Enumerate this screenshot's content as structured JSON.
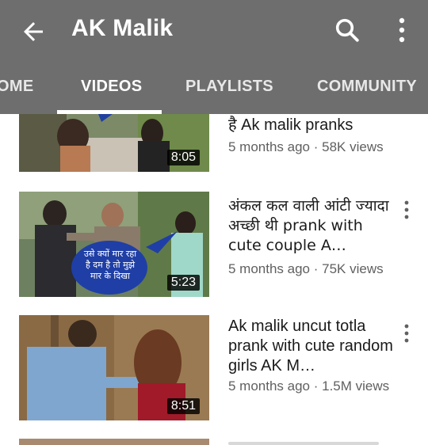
{
  "header": {
    "channel_title": "AK Malik",
    "icons": {
      "back": "arrow-back-icon",
      "search": "search-icon",
      "more": "more-vertical-icon"
    }
  },
  "tabs": [
    {
      "label": "HOME",
      "visible_text": "OME",
      "active": false
    },
    {
      "label": "VIDEOS",
      "active": true
    },
    {
      "label": "PLAYLISTS",
      "active": false
    },
    {
      "label": "COMMUNITY",
      "active": false
    }
  ],
  "videos": [
    {
      "title_visible": "है Ak malik pranks",
      "meta": "5 months ago · 58K views",
      "duration": "8:05"
    },
    {
      "title": "अंकल कल वाली आंटी ज्यादा अच्छी थी prank with cute couple A…",
      "meta": "5 months ago · 75K views",
      "duration": "5:23",
      "bubble_text": [
        "उसे क्यों मार रहा",
        "है दम है तो मुझे",
        "मार के दिखा"
      ]
    },
    {
      "title": "Ak malik uncut totla prank with cute random girls AK M…",
      "meta": "5 months ago · 1.5M views",
      "duration": "8:51"
    }
  ],
  "colors": {
    "appbar": "#6e6e6e",
    "text_primary": "#1a1a1a",
    "text_secondary": "#606060",
    "bubble": "#1f3fa6"
  }
}
